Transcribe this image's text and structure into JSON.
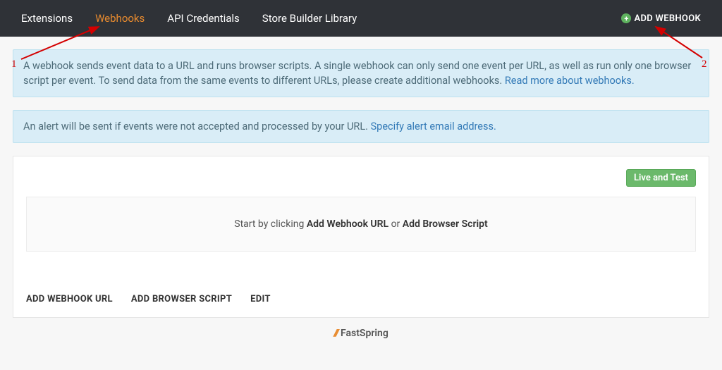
{
  "nav": {
    "items": [
      {
        "label": "Extensions",
        "active": false
      },
      {
        "label": "Webhooks",
        "active": true
      },
      {
        "label": "API Credentials",
        "active": false
      },
      {
        "label": "Store Builder Library",
        "active": false
      }
    ],
    "add_button": "ADD WEBHOOK"
  },
  "info1": {
    "text_a": "A webhook sends event data to a URL and runs browser scripts. A single webhook can only send one event per URL, as well as run only one browser script per event. To send data from the same events to different URLs, please create additional webhooks. ",
    "link": "Read more about webhooks."
  },
  "info2": {
    "text_a": "An alert will be sent if events were not accepted and processed by your URL. ",
    "link": "Specify alert email address."
  },
  "card": {
    "badge": "Live and Test",
    "empty_prefix": "Start by clicking ",
    "empty_bold1": "Add Webhook URL",
    "empty_mid": " or ",
    "empty_bold2": "Add Browser Script",
    "actions": {
      "add_url": "ADD WEBHOOK URL",
      "add_script": "ADD BROWSER SCRIPT",
      "edit": "EDIT"
    }
  },
  "footer": {
    "brand": "FastSpring"
  },
  "annotations": {
    "n1": "1",
    "n2": "2"
  }
}
